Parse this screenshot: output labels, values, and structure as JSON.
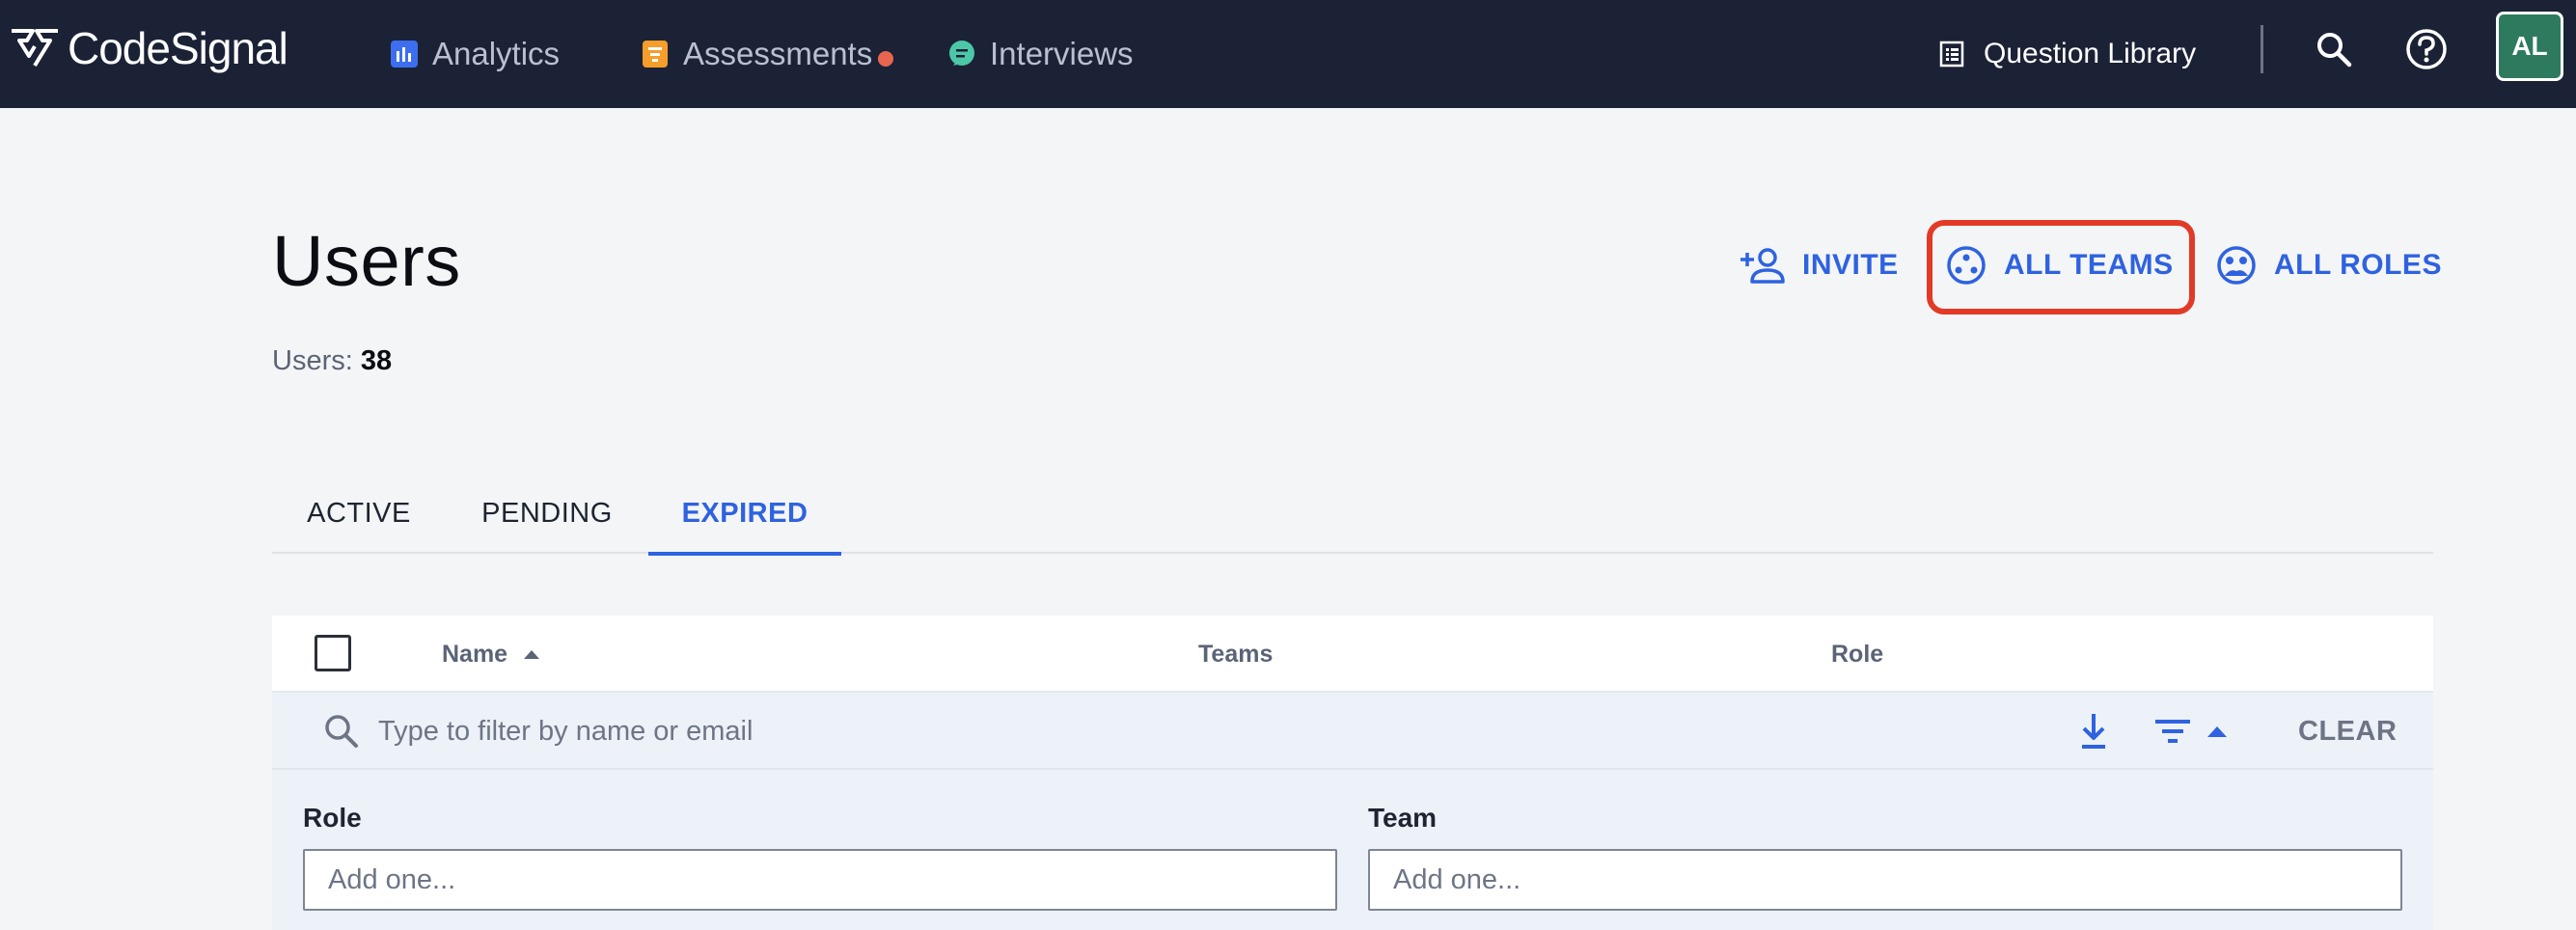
{
  "brand": {
    "name": "CodeSignal"
  },
  "nav": {
    "items": [
      {
        "label": "Analytics",
        "icon": "analytics-icon",
        "color": "#3d6ef0"
      },
      {
        "label": "Assessments",
        "icon": "assessments-icon",
        "color": "#f59e2b",
        "has_notification": true
      },
      {
        "label": "Interviews",
        "icon": "interviews-icon",
        "color": "#4cc7a8"
      }
    ],
    "question_library": "Question Library",
    "avatar_initials": "AL"
  },
  "header": {
    "title": "Users",
    "count_label": "Users:",
    "count_value": "38"
  },
  "actions": {
    "invite": "INVITE",
    "all_teams": "ALL TEAMS",
    "all_roles": "ALL ROLES"
  },
  "tabs": [
    {
      "label": "ACTIVE",
      "active": false
    },
    {
      "label": "PENDING",
      "active": false
    },
    {
      "label": "EXPIRED",
      "active": true
    }
  ],
  "table": {
    "columns": [
      "Name",
      "Teams",
      "Role"
    ],
    "sort_column": "Name",
    "sort_direction": "ascending",
    "filter_placeholder": "Type to filter by name or email",
    "clear_label": "CLEAR"
  },
  "filters": {
    "role_label": "Role",
    "role_placeholder": "Add one...",
    "team_label": "Team",
    "team_placeholder": "Add one..."
  },
  "colors": {
    "nav_bg": "#1b2236",
    "accent": "#2e62e0",
    "highlight": "#e23a27",
    "avatar_bg": "#2e7a5f"
  }
}
